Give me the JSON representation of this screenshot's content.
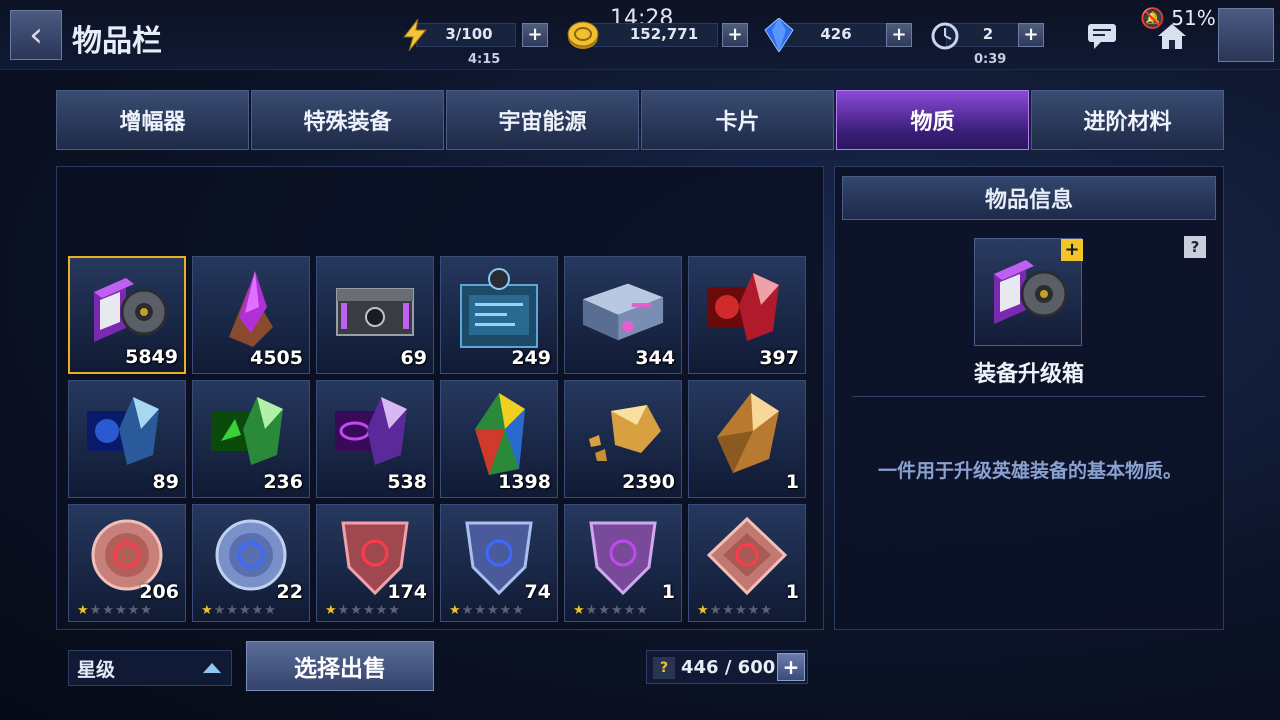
{
  "header": {
    "title": "物品栏",
    "clock": "14:28",
    "battery": "51%",
    "energy": {
      "value": "3/100",
      "timer": "4:15"
    },
    "gold": {
      "value": "152,771"
    },
    "crystal": {
      "value": "426"
    },
    "tickets": {
      "value": "2",
      "timer": "0:39"
    }
  },
  "tabs": [
    {
      "label": "增幅器"
    },
    {
      "label": "特殊装备"
    },
    {
      "label": "宇宙能源"
    },
    {
      "label": "卡片"
    },
    {
      "label": "物质",
      "active": true
    },
    {
      "label": "进阶材料"
    }
  ],
  "items": [
    {
      "count": "5849",
      "icon": "gear-box-icon",
      "selected": true
    },
    {
      "count": "4505",
      "icon": "purple-crystal-icon"
    },
    {
      "count": "69",
      "icon": "chest-icon"
    },
    {
      "count": "249",
      "icon": "data-device-icon"
    },
    {
      "count": "344",
      "icon": "case-icon"
    },
    {
      "count": "397",
      "icon": "red-crystal-icon"
    },
    {
      "count": "89",
      "icon": "blue-crystal-icon"
    },
    {
      "count": "236",
      "icon": "green-crystal-icon"
    },
    {
      "count": "538",
      "icon": "violet-crystal-icon"
    },
    {
      "count": "1398",
      "icon": "rainbow-crystal-icon"
    },
    {
      "count": "2390",
      "icon": "gold-nugget-icon"
    },
    {
      "count": "1",
      "icon": "gold-crystal-icon"
    },
    {
      "count": "206",
      "icon": "red-coin-icon",
      "stars": 1
    },
    {
      "count": "22",
      "icon": "blue-coin-icon",
      "stars": 1
    },
    {
      "count": "174",
      "icon": "red-shield-icon",
      "stars": 1
    },
    {
      "count": "74",
      "icon": "blue-shield-icon",
      "stars": 1
    },
    {
      "count": "1",
      "icon": "purple-shield-icon",
      "stars": 1
    },
    {
      "count": "1",
      "icon": "red-diamond-icon",
      "stars": 1
    }
  ],
  "info": {
    "heading": "物品信息",
    "help": "?",
    "name": "装备升级箱",
    "description": "一件用于升级英雄装备的基本物质。"
  },
  "footer": {
    "sort_label": "星级",
    "sell_label": "选择出售",
    "capacity": "446 / 600",
    "capacity_help": "?"
  }
}
